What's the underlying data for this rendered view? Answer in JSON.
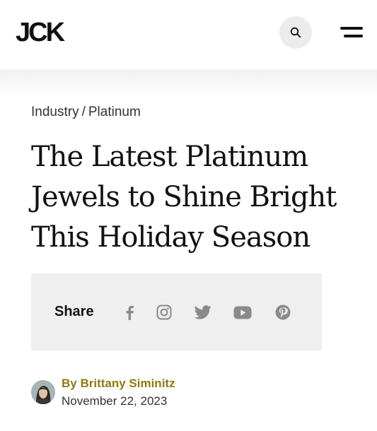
{
  "header": {
    "logo_text": "JCK",
    "search_icon": "search-icon",
    "menu_icon": "hamburger-menu-icon"
  },
  "breadcrumb": {
    "items": [
      {
        "label": "Industry"
      },
      {
        "label": "Platinum"
      }
    ],
    "separator": "/"
  },
  "article": {
    "title_lines": [
      "The Latest Platinum",
      "Jewels to Shine Bright",
      "This Holiday Season"
    ]
  },
  "share": {
    "label": "Share",
    "icons": [
      {
        "name": "facebook-icon"
      },
      {
        "name": "instagram-icon"
      },
      {
        "name": "twitter-icon"
      },
      {
        "name": "youtube-icon"
      },
      {
        "name": "pinterest-icon"
      }
    ],
    "icon_color": "#8a8a8a",
    "background": "#efefef"
  },
  "author": {
    "byline": "By Brittany Siminitz",
    "date": "November 22, 2023",
    "byline_color": "#8e7a16"
  }
}
